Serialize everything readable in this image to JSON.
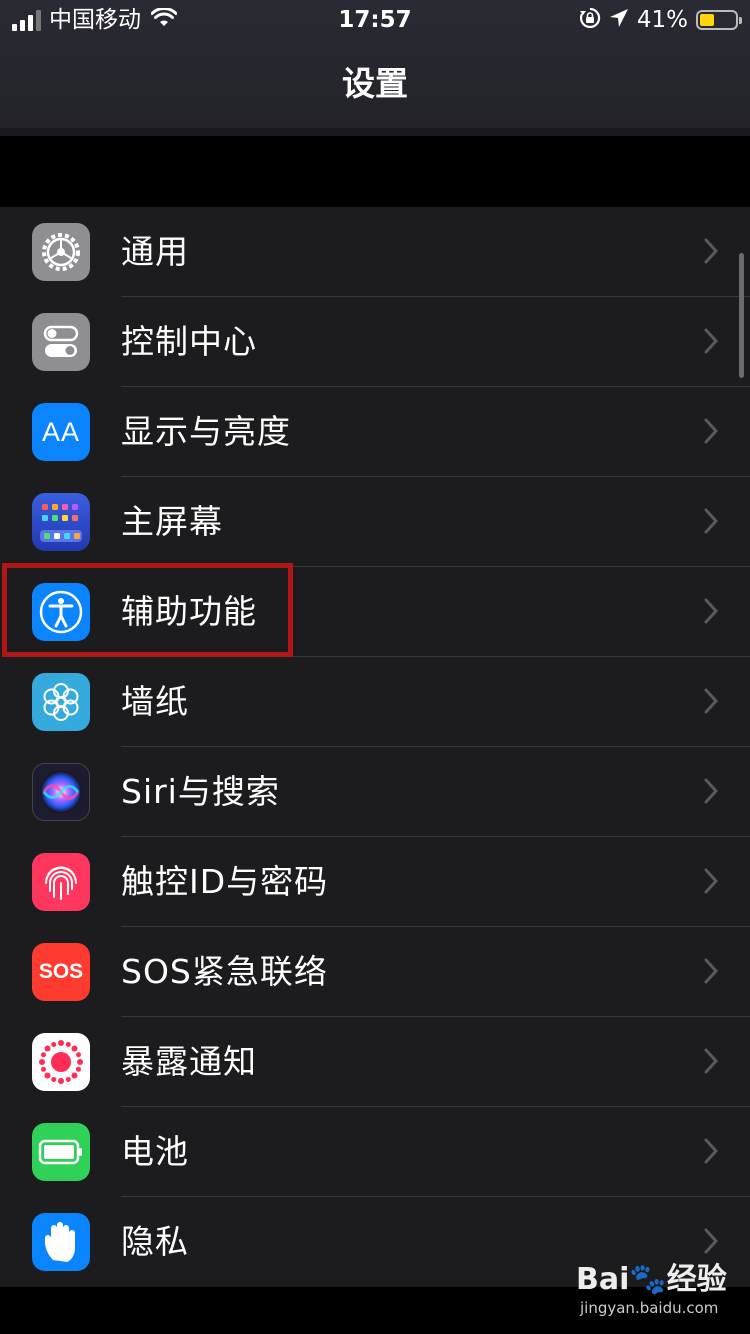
{
  "status_bar": {
    "carrier": "中国移动",
    "time": "17:57",
    "battery_percent": "41%",
    "battery_color": "#ffd60a",
    "icons": [
      "signal-icon",
      "wifi-icon",
      "rotation-lock-icon",
      "location-icon",
      "battery-icon"
    ]
  },
  "nav": {
    "title": "设置"
  },
  "settings": {
    "items": [
      {
        "label": "通用",
        "icon": "gear-icon",
        "color": "#8e8e93"
      },
      {
        "label": "控制中心",
        "icon": "toggles-icon",
        "color": "#8e8e93"
      },
      {
        "label": "显示与亮度",
        "icon": "aa-text-icon",
        "color": "#0a84ff",
        "icon_text": "AA"
      },
      {
        "label": "主屏幕",
        "icon": "home-screen-grid-icon",
        "color": "#2c4dd6"
      },
      {
        "label": "辅助功能",
        "icon": "accessibility-icon",
        "color": "#0a84ff"
      },
      {
        "label": "墙纸",
        "icon": "flower-icon",
        "color": "#35aadc"
      },
      {
        "label": "Siri与搜索",
        "icon": "siri-icon",
        "color": "#1c1c2e"
      },
      {
        "label": "触控ID与密码",
        "icon": "fingerprint-icon",
        "color": "#ff375f"
      },
      {
        "label": "SOS紧急联络",
        "icon": "sos-icon",
        "color": "#ff3b30",
        "icon_text": "SOS"
      },
      {
        "label": "暴露通知",
        "icon": "exposure-icon",
        "color": "#ffffff"
      },
      {
        "label": "电池",
        "icon": "battery-settings-icon",
        "color": "#30d158"
      },
      {
        "label": "隐私",
        "icon": "hand-icon",
        "color": "#0a84ff"
      }
    ],
    "highlighted_item": "辅助功能"
  },
  "watermark": {
    "brand": "Bai🐾经验",
    "url": "jingyan.baidu.com"
  }
}
